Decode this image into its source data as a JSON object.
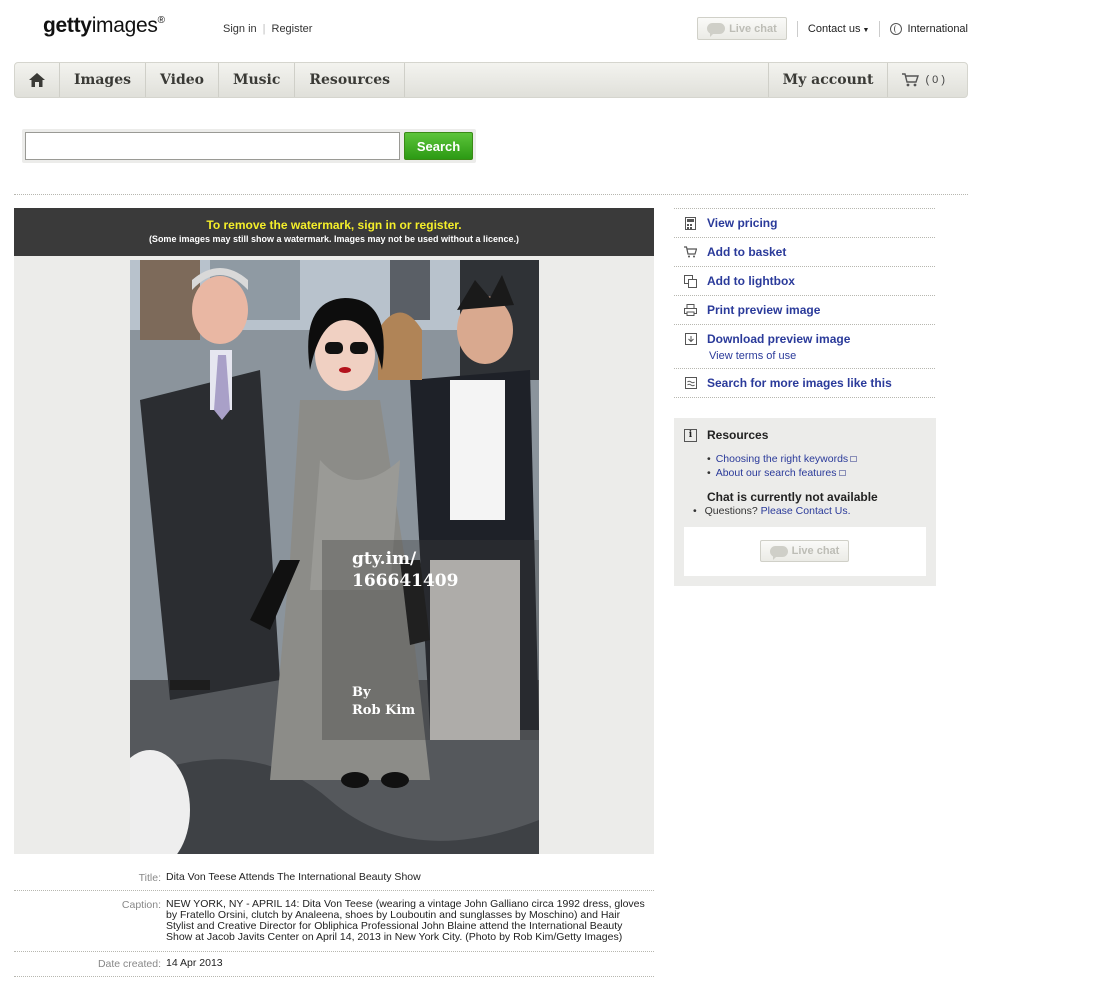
{
  "header": {
    "logo_bold": "getty",
    "logo_rest": "images",
    "logo_mark": "®",
    "sign_in": "Sign in",
    "register": "Register",
    "live_chat": "Live chat",
    "contact_us": "Contact us",
    "international": "International"
  },
  "nav": {
    "home_icon": "home-icon",
    "items": [
      "Images",
      "Video",
      "Music",
      "Resources"
    ],
    "my_account": "My account",
    "cart_count": "( 0 )"
  },
  "search": {
    "value": "",
    "button_label": "Search"
  },
  "banner": {
    "title": "To remove the watermark, sign in or register.",
    "subtitle": "(Some images may still show a watermark. Images may not be used without a licence.)"
  },
  "watermark": {
    "line1": "gty.im/",
    "line2": "166641409",
    "by": "By",
    "photographer": "Rob Kim"
  },
  "details": {
    "title_label": "Title:",
    "title_value": "Dita Von Teese Attends The International Beauty Show",
    "caption_label": "Caption:",
    "caption_value": "NEW YORK, NY - APRIL 14: Dita Von Teese (wearing a vintage John Galliano circa 1992 dress, gloves by Fratello Orsini, clutch by Analeena, shoes by Louboutin and sunglasses by Moschino) and Hair Stylist and Creative Director for Obliphica Professional John Blaine attend the International Beauty Show at Jacob Javits Center on April 14, 2013 in New York City. (Photo by Rob Kim/Getty Images)",
    "date_label": "Date created:",
    "date_value": "14 Apr 2013"
  },
  "actions": {
    "view_pricing": "View pricing",
    "add_to_basket": "Add to basket",
    "add_to_lightbox": "Add to lightbox",
    "print_preview": "Print preview image",
    "download_preview": "Download preview image",
    "view_terms": "View terms of use",
    "search_more": "Search for more images like this"
  },
  "resources": {
    "heading": "Resources",
    "link1": "Choosing the right keywords",
    "link2": "About our search features",
    "chat_status": "Chat is currently not available",
    "questions_prefix": "Questions?",
    "contact_link": "Please Contact Us.",
    "live_chat": "Live chat"
  },
  "colors": {
    "banner_bg": "#3a3a3a",
    "banner_title": "#f4ee2a",
    "link_blue": "#2a3a9a",
    "search_green": "#3aaa1e"
  }
}
